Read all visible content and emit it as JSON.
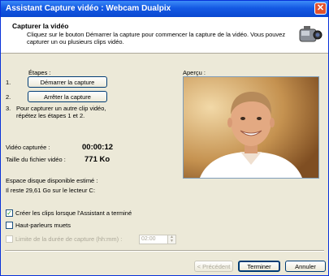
{
  "window": {
    "title": "Assistant Capture vidéo : Webcam Dualpix",
    "close": "✕"
  },
  "header": {
    "title": "Capturer la vidéo",
    "description": "Cliquez sur le bouton Démarrer la capture pour commencer la capture de la vidéo. Vous pouvez capturer un ou plusieurs clips vidéo."
  },
  "steps": {
    "label": "Étapes :",
    "step1_num": "1.",
    "step1_button": "Démarrer la capture",
    "step2_num": "2.",
    "step2_button": "Arrêter la capture",
    "step3_num": "3.",
    "step3_text": "Pour capturer un autre clip vidéo, répétez les étapes 1 et 2."
  },
  "stats": {
    "captured_label": "Vidéo capturée :",
    "captured_value": "00:00:12",
    "size_label": "Taille du fichier vidéo :",
    "size_value": "771 Ko",
    "disk_label": "Espace disque disponible estimé :",
    "disk_value": "Il reste 29,61 Go sur le lecteur C:"
  },
  "preview": {
    "label": "Aperçu :"
  },
  "options": {
    "create_clips": {
      "label": "Créer les clips lorsque l'Assistant a terminé",
      "checked": true
    },
    "mute": {
      "label": "Haut-parleurs muets",
      "checked": false
    },
    "limit": {
      "label": "Limite de la durée de capture (hh:mm) :",
      "checked": false,
      "value": "02:00"
    }
  },
  "footer": {
    "back": "< Précédent",
    "finish": "Terminer",
    "cancel": "Annuler"
  }
}
